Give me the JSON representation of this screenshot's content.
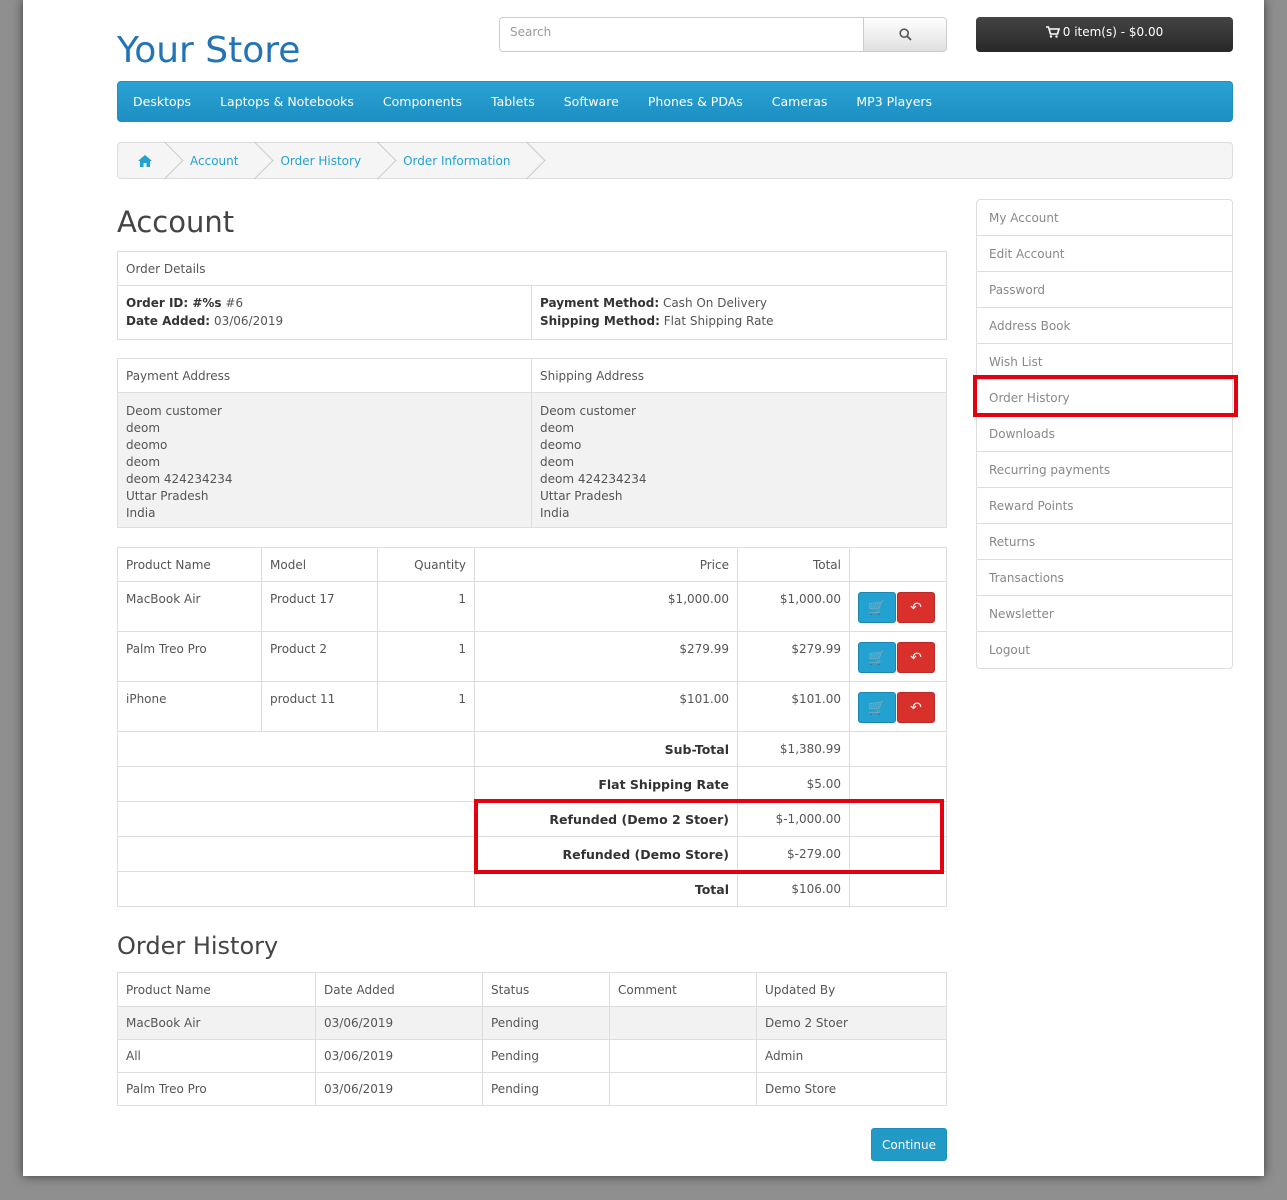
{
  "header": {
    "store_name": "Your Store",
    "search_placeholder": "Search",
    "cart_label": "0 item(s) - $0.00"
  },
  "menu": [
    "Desktops",
    "Laptops & Notebooks",
    "Components",
    "Tablets",
    "Software",
    "Phones & PDAs",
    "Cameras",
    "MP3 Players"
  ],
  "breadcrumb": [
    "Account",
    "Order History",
    "Order Information"
  ],
  "page_title": "Account",
  "order_details": {
    "heading": "Order Details",
    "order_id_label": "Order ID: #%s",
    "order_id": "#6",
    "date_added_label": "Date Added:",
    "date_added": "03/06/2019",
    "payment_method_label": "Payment Method:",
    "payment_method": "Cash On Delivery",
    "shipping_method_label": "Shipping Method:",
    "shipping_method": "Flat Shipping Rate"
  },
  "addresses": {
    "payment_heading": "Payment Address",
    "shipping_heading": "Shipping Address",
    "payment_lines": [
      "Deom customer",
      "deom",
      "deomo",
      "deom",
      "deom 424234234",
      "Uttar Pradesh",
      "India"
    ],
    "shipping_lines": [
      "Deom customer",
      "deom",
      "deomo",
      "deom",
      "deom 424234234",
      "Uttar Pradesh",
      "India"
    ]
  },
  "products": {
    "headers": [
      "Product Name",
      "Model",
      "Quantity",
      "Price",
      "Total"
    ],
    "rows": [
      {
        "name": "MacBook Air",
        "model": "Product 17",
        "qty": "1",
        "price": "$1,000.00",
        "total": "$1,000.00"
      },
      {
        "name": "Palm Treo Pro",
        "model": "Product 2",
        "qty": "1",
        "price": "$279.99",
        "total": "$279.99"
      },
      {
        "name": "iPhone",
        "model": "product 11",
        "qty": "1",
        "price": "$101.00",
        "total": "$101.00"
      }
    ],
    "totals": [
      {
        "label": "Sub-Total",
        "value": "$1,380.99"
      },
      {
        "label": "Flat Shipping Rate",
        "value": "$5.00"
      },
      {
        "label": "Refunded (Demo 2 Stoer)",
        "value": "$-1,000.00"
      },
      {
        "label": "Refunded (Demo Store)",
        "value": "$-279.00"
      },
      {
        "label": "Total",
        "value": "$106.00"
      }
    ]
  },
  "order_history": {
    "title": "Order History",
    "headers": [
      "Product Name",
      "Date Added",
      "Status",
      "Comment",
      "Updated By"
    ],
    "rows": [
      {
        "product": "MacBook Air",
        "date": "03/06/2019",
        "status": "Pending",
        "comment": "",
        "by": "Demo 2 Stoer"
      },
      {
        "product": "All",
        "date": "03/06/2019",
        "status": "Pending",
        "comment": "",
        "by": "Admin"
      },
      {
        "product": "Palm Treo Pro",
        "date": "03/06/2019",
        "status": "Pending",
        "comment": "",
        "by": "Demo Store"
      }
    ]
  },
  "continue_label": "Continue",
  "sidebar": [
    "My Account",
    "Edit Account",
    "Password",
    "Address Book",
    "Wish List",
    "Order History",
    "Downloads",
    "Recurring payments",
    "Reward Points",
    "Returns",
    "Transactions",
    "Newsletter",
    "Logout"
  ],
  "colors": {
    "accent": "#23a1d1",
    "highlight": "#e4000f",
    "danger": "#d9302c"
  }
}
